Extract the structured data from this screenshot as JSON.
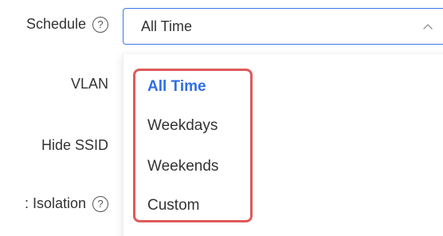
{
  "form": {
    "schedule_label": "Schedule",
    "vlan_label": "VLAN",
    "hide_ssid_label": "Hide SSID",
    "isolation_label": ": Isolation",
    "help_glyph": "?"
  },
  "schedule_select": {
    "value": "All Time",
    "open": true
  },
  "dropdown": {
    "options": [
      {
        "label": "All Time",
        "selected": true
      },
      {
        "label": "Weekdays",
        "selected": false
      },
      {
        "label": "Weekends",
        "selected": false
      },
      {
        "label": "Custom",
        "selected": false
      }
    ]
  },
  "colors": {
    "accent": "#2f6fe4",
    "select_border": "#3b78e7",
    "highlight_box": "#e05a5a",
    "text": "#333333"
  },
  "icons": {
    "help": "help-circle-icon",
    "chevron": "chevron-up-icon"
  }
}
